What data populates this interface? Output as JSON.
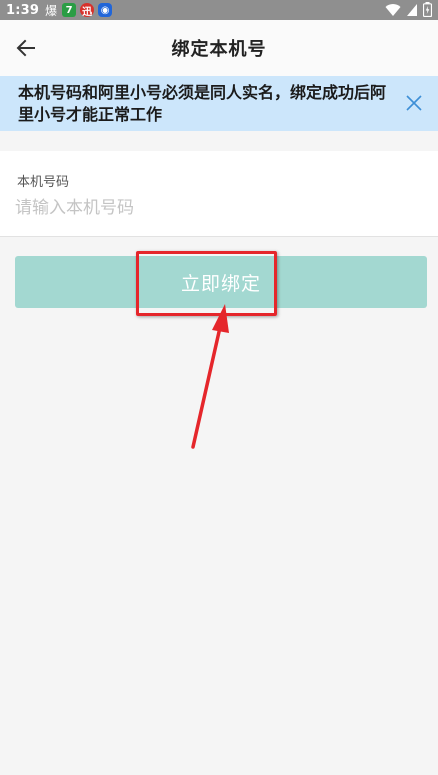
{
  "status_bar": {
    "time": "1:39",
    "glyph": "爆",
    "notif_1": "7",
    "notif_2": "迅",
    "notif_3": "◉"
  },
  "nav": {
    "title": "绑定本机号"
  },
  "notice": {
    "text": "本机号码和阿里小号必须是同人实名，绑定成功后阿里小号才能正常工作"
  },
  "phone_field": {
    "label": "本机号码",
    "value": "",
    "placeholder": "请输入本机号码"
  },
  "bind_button": {
    "label": "立即绑定"
  },
  "colors": {
    "status_bar_bg": "#8f8f8f",
    "banner_bg": "#cce6fb",
    "close_icon": "#3d8fd6",
    "button_bg": "#a3d8d1",
    "annotation_red": "#e5262b"
  },
  "icons": {
    "back": "arrow-left-icon",
    "close": "close-icon",
    "wifi": "wifi-icon",
    "signal": "signal-icon",
    "battery": "battery-icon"
  }
}
